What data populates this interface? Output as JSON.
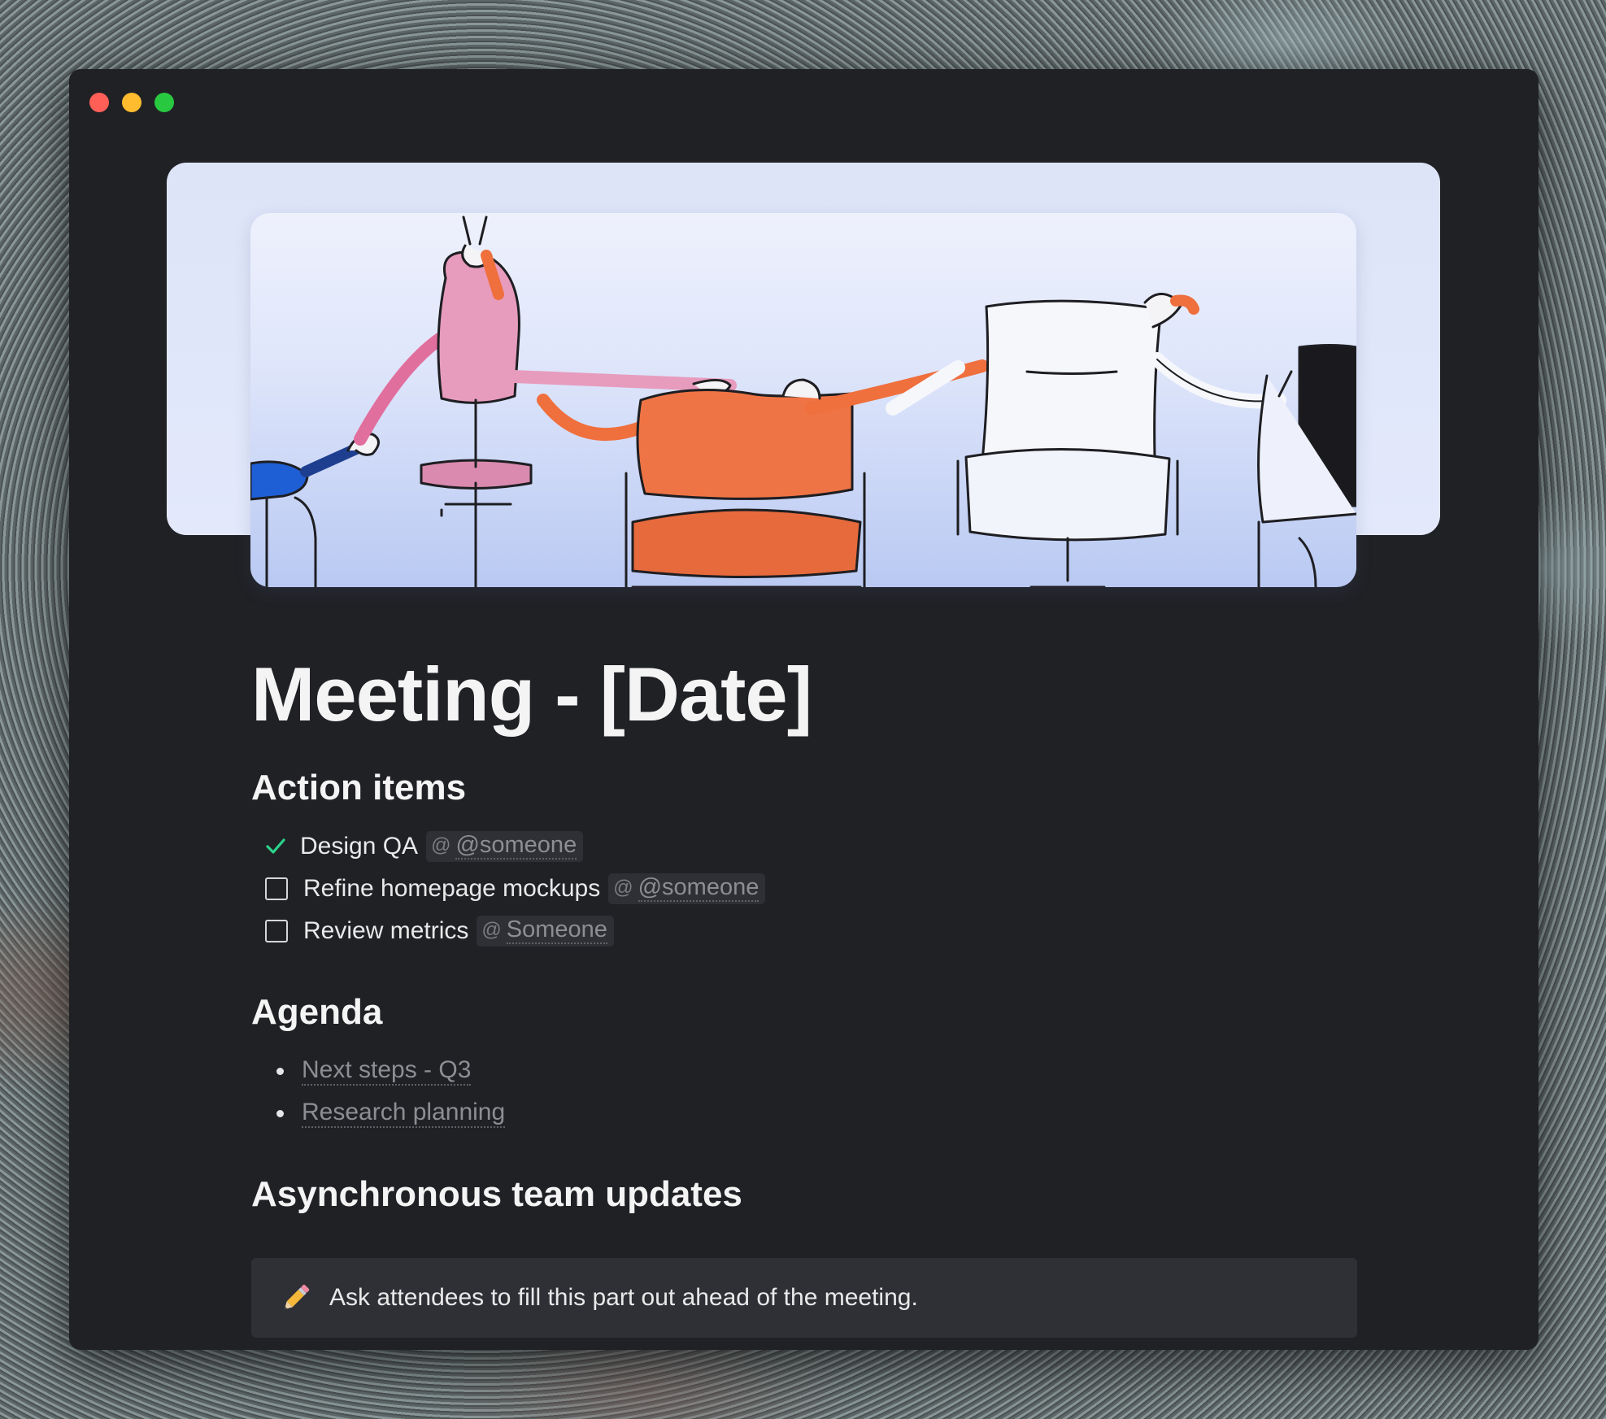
{
  "page": {
    "title": "Meeting - [Date]"
  },
  "colors": {
    "window_bg": "#202125",
    "check_accent": "#2bd48b",
    "mention_bg": "#2f3035",
    "callout_bg": "#2f3036"
  },
  "sections": {
    "action_items": {
      "heading": "Action items",
      "items": [
        {
          "label": "Design QA",
          "mention": "@someone",
          "checked": true
        },
        {
          "label": "Refine homepage mockups",
          "mention": "@someone",
          "checked": false
        },
        {
          "label": "Review metrics",
          "mention": "Someone",
          "checked": false
        }
      ],
      "mention_prefix": "@"
    },
    "agenda": {
      "heading": "Agenda",
      "items": [
        "Next steps - Q3",
        "Research planning"
      ]
    },
    "async_updates": {
      "heading": "Asynchronous team updates",
      "callout": {
        "icon": "pencil-icon",
        "text": "Ask attendees to fill this part out ahead of the meeting."
      }
    }
  }
}
